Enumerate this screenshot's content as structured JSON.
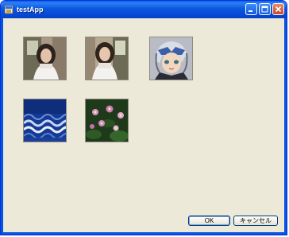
{
  "window": {
    "title": "testApp"
  },
  "caption_buttons": [
    "minimize-icon",
    "maximize-icon",
    "close-icon"
  ],
  "images": [
    {
      "name": "girl-window-photo-1"
    },
    {
      "name": "girl-window-photo-2"
    },
    {
      "name": "anime-character-portrait"
    },
    {
      "name": "blue-wave-texture"
    },
    {
      "name": "pink-flowers-photo"
    }
  ],
  "buttons": {
    "ok": "OK",
    "cancel": "キャンセル"
  },
  "colors": {
    "titlebar": "#0a5ee8",
    "window_bg": "#ece9d8",
    "close_button": "#c94a26"
  }
}
